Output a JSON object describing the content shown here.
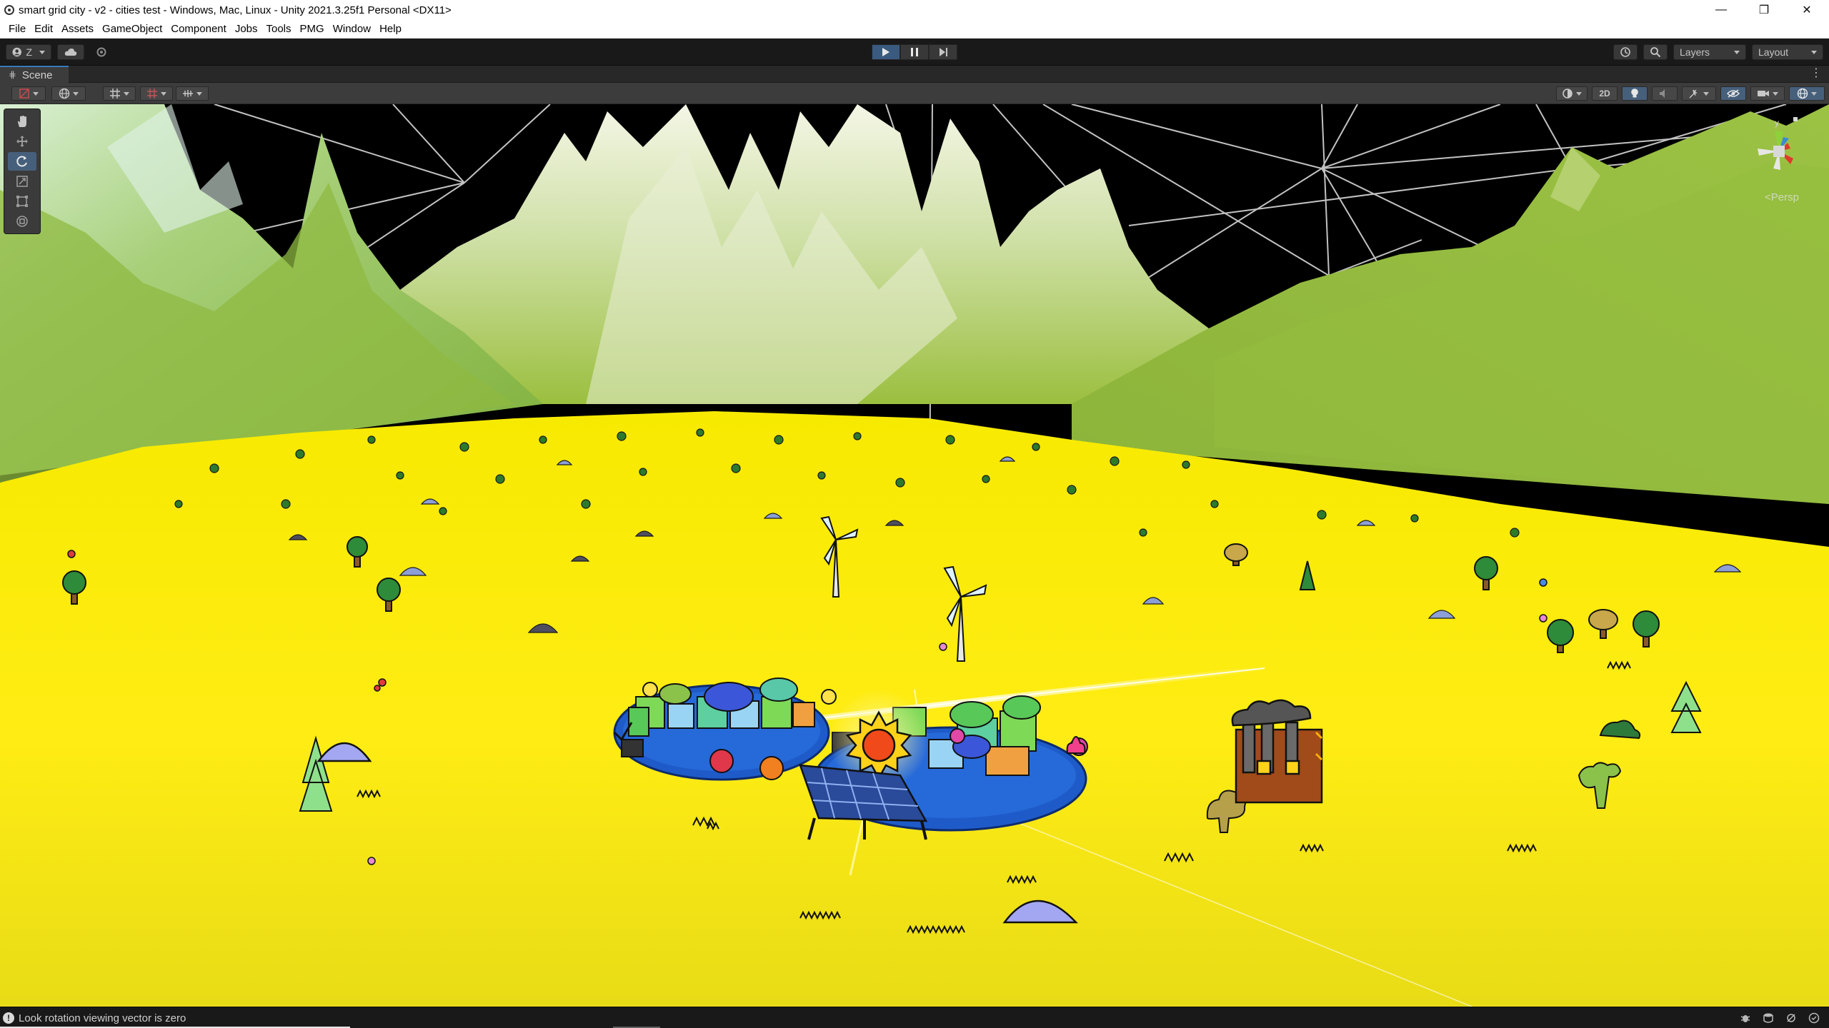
{
  "window": {
    "title": "smart grid city - v2 - cities test - Windows, Mac, Linux - Unity 2021.3.25f1 Personal <DX11>",
    "minimize": "—",
    "maximize": "❐",
    "close": "✕"
  },
  "menu": [
    "File",
    "Edit",
    "Assets",
    "GameObject",
    "Component",
    "Jobs",
    "Tools",
    "PMG",
    "Window",
    "Help"
  ],
  "toolbar": {
    "account_label": "Z",
    "layers_label": "Layers",
    "layout_label": "Layout",
    "play_state": "playing"
  },
  "scene_tab": {
    "label": "Scene"
  },
  "scene_toolbar": {
    "mode_2d_label": "2D"
  },
  "viewport": {
    "projection_label": "<Persp",
    "gizmo_axis_label": "y",
    "colors": {
      "ground": "#f2e600",
      "sky": "#000000",
      "mountains": "#9cc23a",
      "water": "#1e5bc8",
      "wireframe": "#dcdcdc"
    }
  },
  "status": {
    "message": "Look rotation viewing vector is zero"
  }
}
